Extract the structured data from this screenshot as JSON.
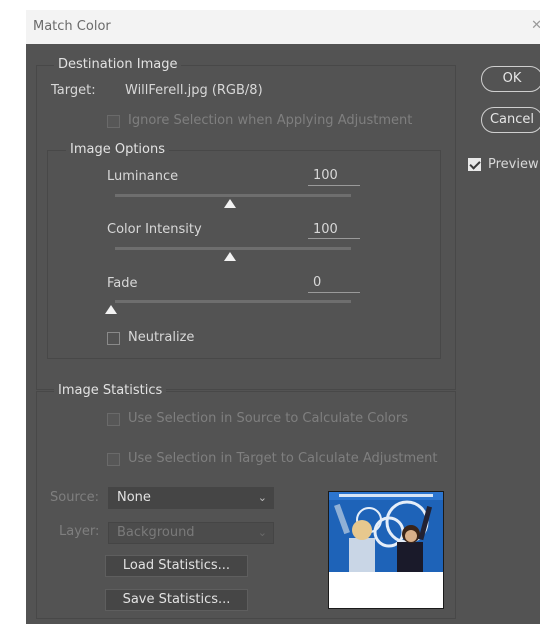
{
  "window": {
    "title": "Match Color"
  },
  "buttons": {
    "ok": "OK",
    "cancel": "Cancel",
    "preview": "Preview"
  },
  "destination": {
    "legend": "Destination Image",
    "target_label": "Target:",
    "target_value": "WillFerell.jpg (RGB/8)",
    "ignore_selection": "Ignore Selection when Applying Adjustment"
  },
  "options": {
    "legend": "Image Options",
    "luminance": {
      "label": "Luminance",
      "value": "100",
      "level": 0.5
    },
    "intensity": {
      "label": "Color Intensity",
      "value": "100",
      "level": 0.5
    },
    "fade": {
      "label": "Fade",
      "value": "0",
      "level": 0
    },
    "neutralize": "Neutralize"
  },
  "statistics": {
    "legend": "Image Statistics",
    "use_source": "Use Selection in Source to Calculate Colors",
    "use_target": "Use Selection in Target to Calculate Adjustment",
    "source_label": "Source:",
    "source_value": "None",
    "layer_label": "Layer:",
    "layer_value": "Background",
    "load": "Load Statistics...",
    "save": "Save Statistics..."
  },
  "colors": {
    "dialog_bg": "#535353",
    "thumbnail_blue": "#1e63b8"
  }
}
